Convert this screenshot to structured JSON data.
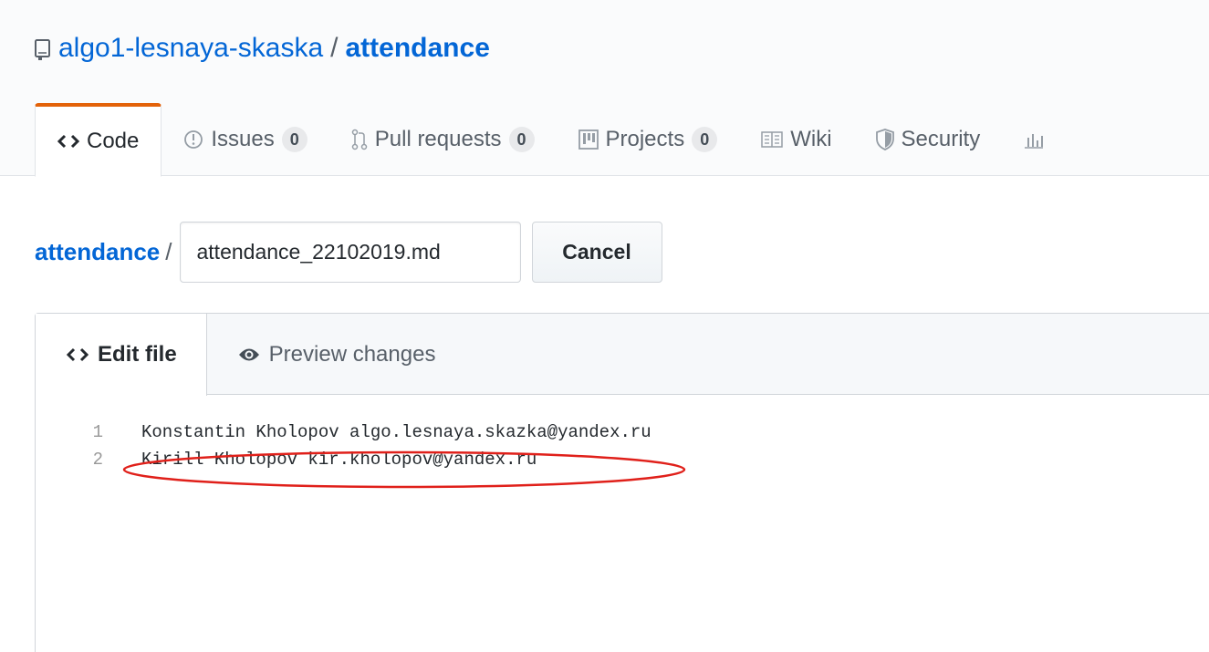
{
  "repo": {
    "owner": "algo1-lesnaya-skaska",
    "separator": "/",
    "name": "attendance"
  },
  "tabs": [
    {
      "label": "Code",
      "icon": "code-icon",
      "selected": true
    },
    {
      "label": "Issues",
      "icon": "issue-icon",
      "count": "0"
    },
    {
      "label": "Pull requests",
      "icon": "pull-request-icon",
      "count": "0"
    },
    {
      "label": "Projects",
      "icon": "project-icon",
      "count": "0"
    },
    {
      "label": "Wiki",
      "icon": "book-icon"
    },
    {
      "label": "Security",
      "icon": "shield-icon"
    }
  ],
  "breadcrumb": {
    "root": "attendance",
    "separator": "/",
    "filename": "attendance_22102019.md",
    "cancel_label": "Cancel"
  },
  "editor": {
    "tabs": [
      {
        "label": "Edit file",
        "icon": "code-icon",
        "selected": true
      },
      {
        "label": "Preview changes",
        "icon": "eye-icon"
      }
    ],
    "lines": [
      {
        "number": "1",
        "text": "Konstantin Kholopov algo.lesnaya.skazka@yandex.ru"
      },
      {
        "number": "2",
        "text": "Kirill Kholopov kir.kholopov@yandex.ru"
      }
    ]
  },
  "colors": {
    "link": "#0366d6",
    "tab_accent": "#e36209",
    "annotation": "#e0201a"
  }
}
